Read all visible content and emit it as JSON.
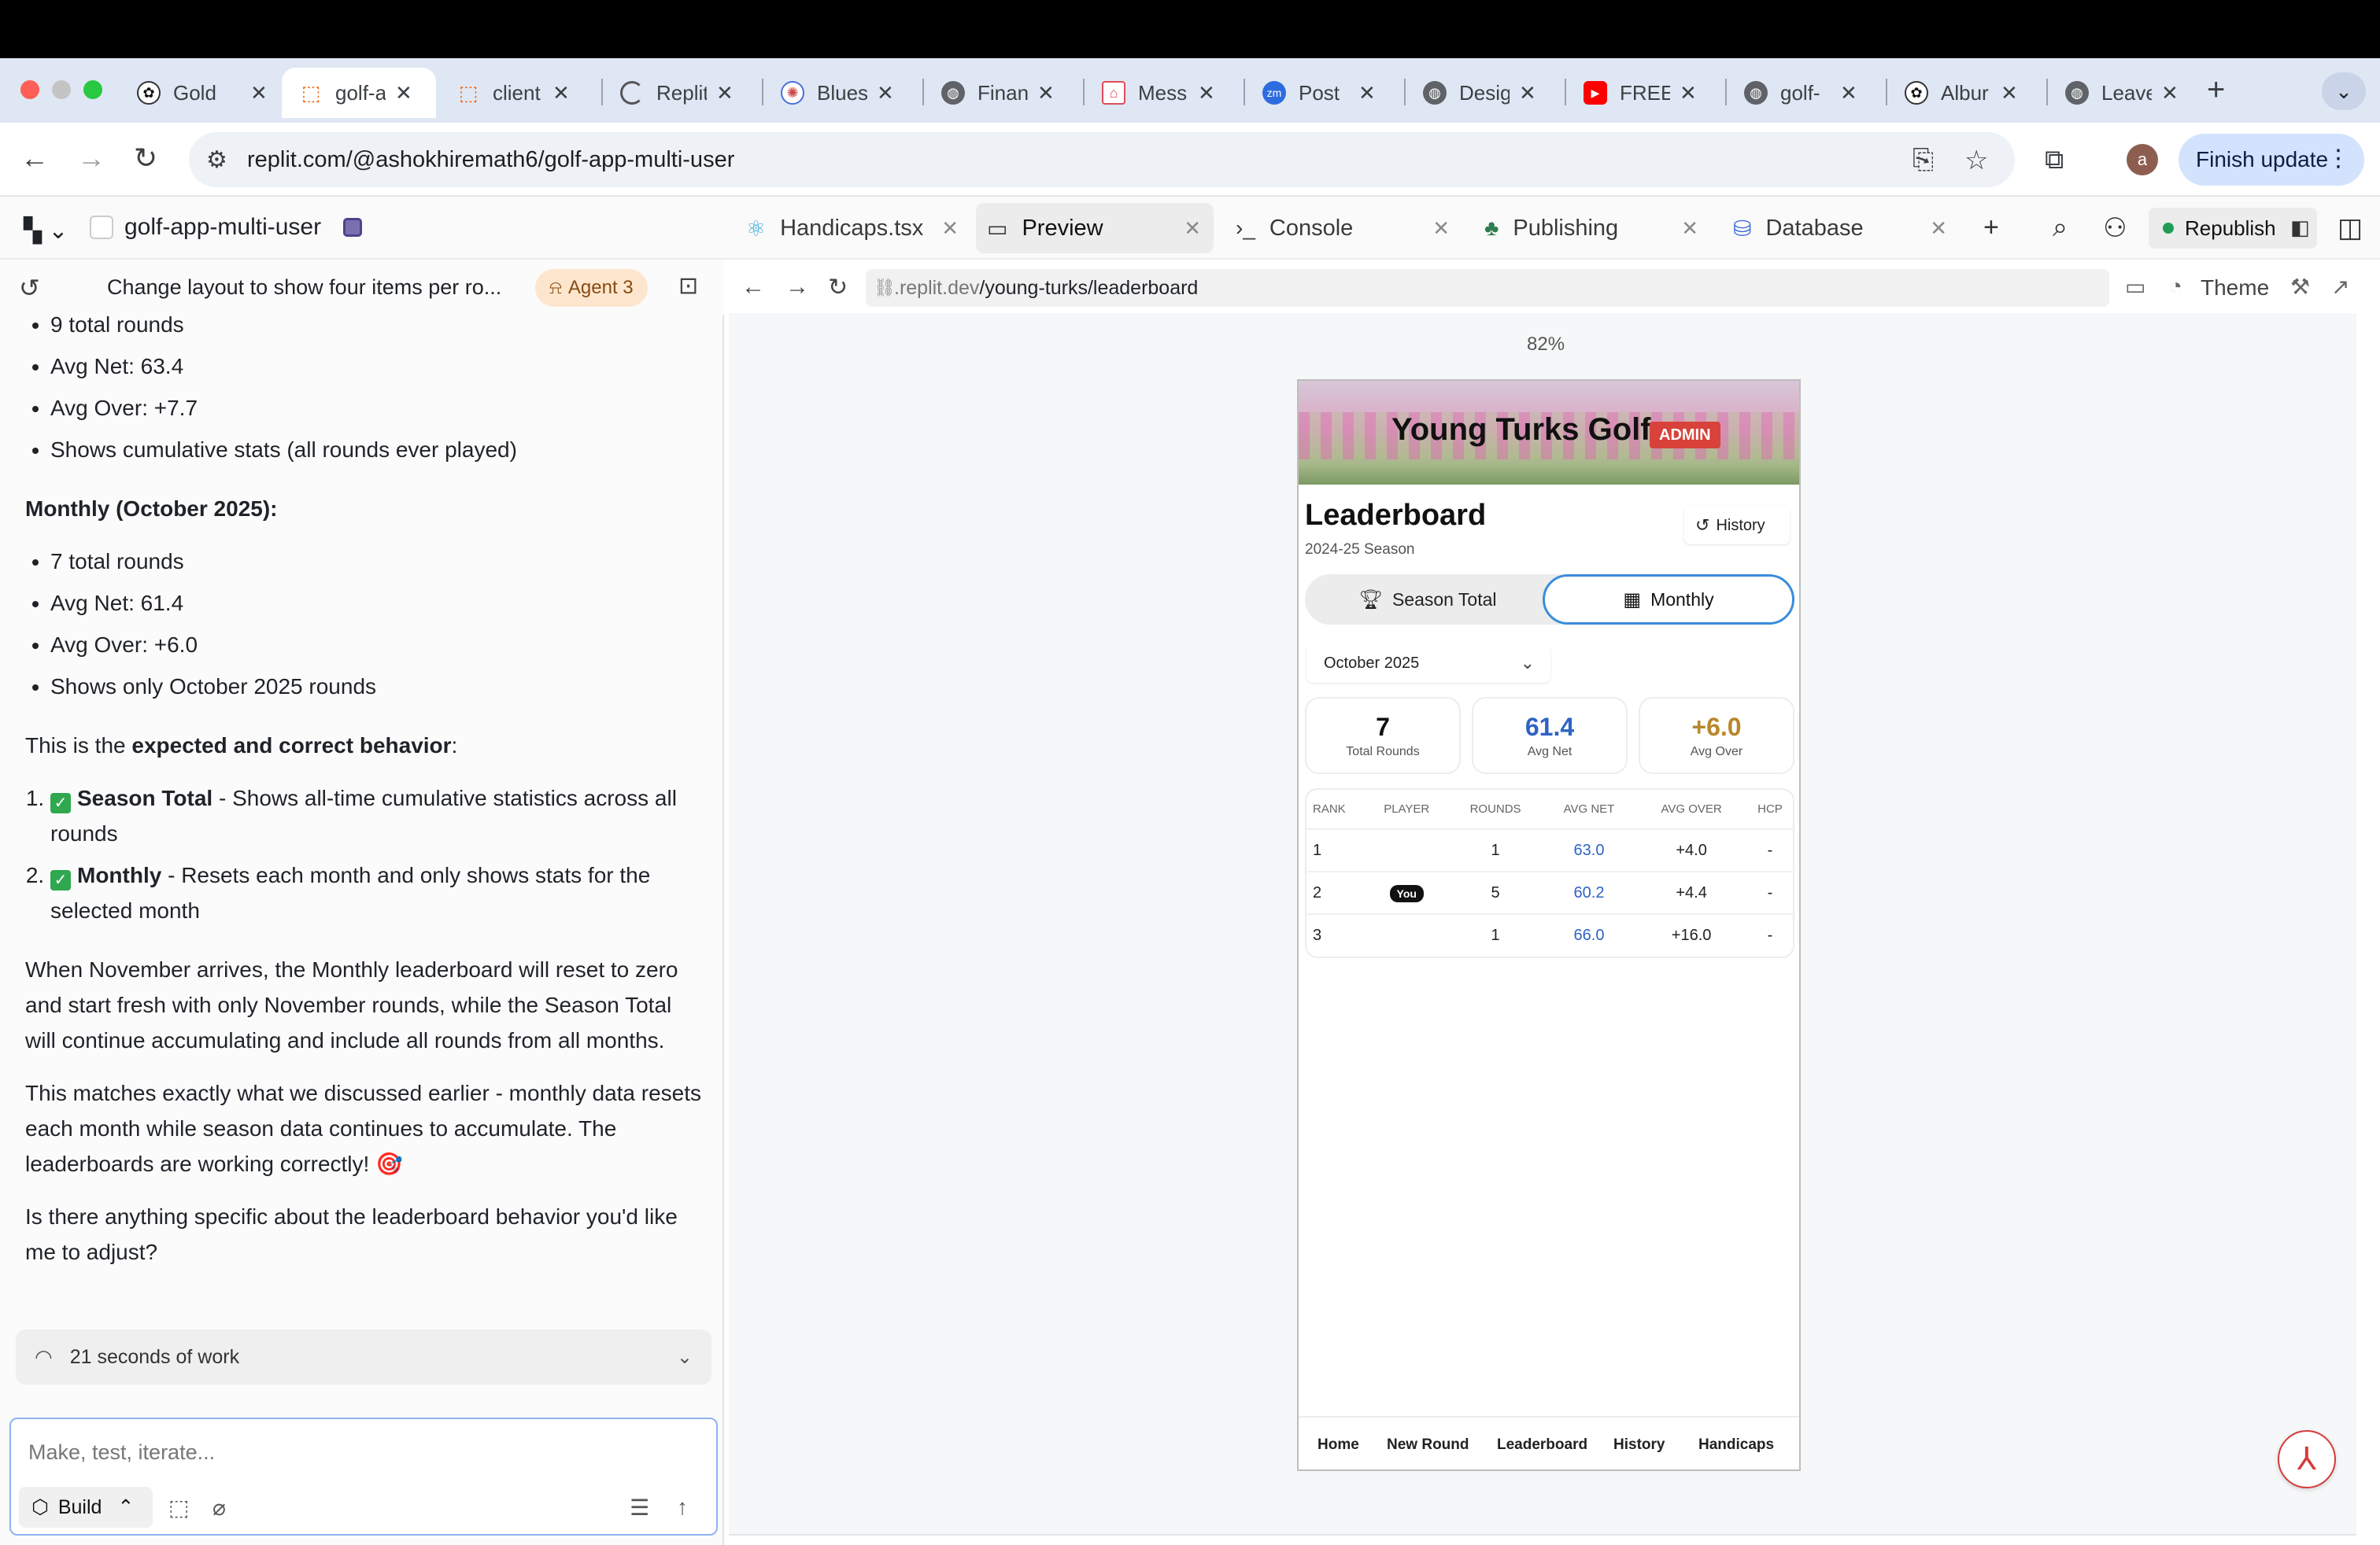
{
  "browser": {
    "tabs": [
      {
        "label": "Gold",
        "icon": "openai-icon"
      },
      {
        "label": "golf-a",
        "icon": "replit-icon",
        "active": true
      },
      {
        "label": "client",
        "icon": "replit-icon"
      },
      {
        "label": "Replit",
        "icon": "loading-icon"
      },
      {
        "label": "Blues",
        "icon": "bluesky-icon"
      },
      {
        "label": "Finan",
        "icon": "globe-icon"
      },
      {
        "label": "Mess",
        "icon": "airbnb-icon"
      },
      {
        "label": "Post",
        "icon": "zoom-icon"
      },
      {
        "label": "Desig",
        "icon": "globe-icon"
      },
      {
        "label": "FREE",
        "icon": "youtube-icon"
      },
      {
        "label": "golf-",
        "icon": "globe-icon"
      },
      {
        "label": "Albur",
        "icon": "openai-icon"
      },
      {
        "label": "Leave",
        "icon": "globe-icon"
      }
    ],
    "url": "replit.com/@ashokhiremath6/golf-app-multi-user",
    "profile_initial": "a",
    "finish_update_label": "Finish update"
  },
  "workspace": {
    "project_name": "golf-app-multi-user",
    "tabs": [
      {
        "label": "Handicaps.tsx",
        "icon": "react-icon"
      },
      {
        "label": "Preview",
        "icon": "monitor-icon",
        "active": true
      },
      {
        "label": "Console",
        "icon": "terminal-icon"
      },
      {
        "label": "Publishing",
        "icon": "publishing-icon"
      },
      {
        "label": "Database",
        "icon": "database-icon"
      }
    ],
    "republish_label": "Republish"
  },
  "agent": {
    "task_title": "Change layout to show four items per ro...",
    "agent_badge": "Agent 3",
    "season_list": [
      "9 total rounds",
      "Avg Net: 63.4",
      "Avg Over: +7.7",
      "Shows cumulative stats (all rounds ever played)"
    ],
    "monthly_heading": "Monthly (October 2025):",
    "monthly_list": [
      "7 total rounds",
      "Avg Net: 61.4",
      "Avg Over: +6.0",
      "Shows only October 2025 rounds"
    ],
    "expected_prefix": "This is the ",
    "expected_bold": "expected and correct behavior",
    "expected_suffix": ":",
    "ordered": [
      {
        "bold": "Season Total",
        "text": " - Shows all-time cumulative statistics across all rounds"
      },
      {
        "bold": "Monthly",
        "text": " - Resets each month and only shows stats for the selected month"
      }
    ],
    "para_november": "When November arrives, the Monthly leaderboard will reset to zero and start fresh with only November rounds, while the Season Total will continue accumulating and include all rounds from all months.",
    "para_matches": "This matches exactly what we discussed earlier - monthly data resets each month while season data continues to accumulate. The leaderboards are working correctly! 🎯",
    "para_question": "Is there anything specific about the leaderboard behavior you'd like me to adjust?",
    "work_summary": "21 seconds of work",
    "composer_placeholder": "Make, test, iterate...",
    "build_label": "Build"
  },
  "preview": {
    "url_prefix": ".replit.dev",
    "url_path": "/young-turks/leaderboard",
    "theme_label": "Theme",
    "zoom": "82%"
  },
  "app": {
    "title": "Young Turks Golf",
    "admin_badge": "ADMIN",
    "page_title": "Leaderboard",
    "season": "2024-25 Season",
    "history_label": "History",
    "toggle_season": "Season Total",
    "toggle_monthly": "Monthly",
    "month": "October 2025",
    "stats": [
      {
        "value": "7",
        "label": "Total Rounds",
        "color": "#111111"
      },
      {
        "value": "61.4",
        "label": "Avg Net",
        "color": "#2f63c4"
      },
      {
        "value": "+6.0",
        "label": "Avg Over",
        "color": "#b8862b"
      }
    ],
    "columns": [
      "RANK",
      "PLAYER",
      "ROUNDS",
      "AVG NET",
      "AVG OVER",
      "HCP"
    ],
    "rows": [
      {
        "rank": "1",
        "player": "",
        "rounds": "1",
        "avg_net": "63.0",
        "avg_over": "+4.0",
        "hcp": "-"
      },
      {
        "rank": "2",
        "player": "You",
        "rounds": "5",
        "avg_net": "60.2",
        "avg_over": "+4.4",
        "hcp": "-"
      },
      {
        "rank": "3",
        "player": "",
        "rounds": "1",
        "avg_net": "66.0",
        "avg_over": "+16.0",
        "hcp": "-"
      }
    ],
    "nav": [
      "Home",
      "New Round",
      "Leaderboard",
      "History",
      "Handicaps"
    ]
  }
}
